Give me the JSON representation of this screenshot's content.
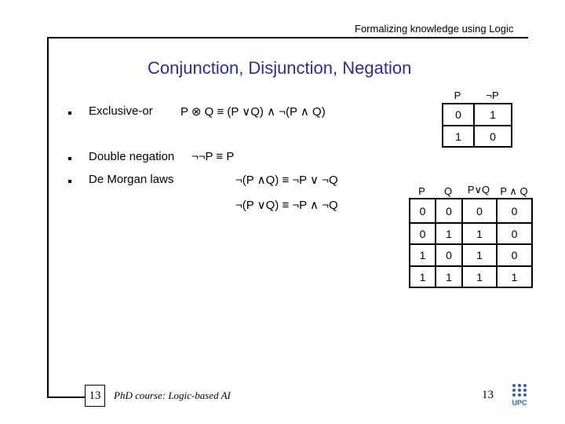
{
  "header": {
    "title": "Formalizing knowledge using Logic"
  },
  "slide": {
    "title": "Conjunction, Disjunction, Negation",
    "items": [
      {
        "label": "Exclusive-or",
        "formula": "P ⊗  Q ≡ (P ∨Q) ∧ ¬(P ∧ Q)"
      },
      {
        "label": "Double negation",
        "formula": "¬¬P ≡ P"
      },
      {
        "label": "De Morgan laws",
        "formulas": [
          "¬(P ∧Q) ≡ ¬P ∨ ¬Q",
          "¬(P ∨Q) ≡ ¬P ∧ ¬Q"
        ]
      }
    ]
  },
  "negation_table": {
    "headers": [
      "P",
      "¬P"
    ],
    "rows": [
      [
        "0",
        "1"
      ],
      [
        "1",
        "0"
      ]
    ]
  },
  "and_or_table": {
    "headers": [
      "P",
      "Q",
      "P∨Q",
      "P ∧ Q"
    ],
    "rows": [
      [
        "0",
        "0",
        "0",
        "0"
      ],
      [
        "0",
        "1",
        "1",
        "0"
      ],
      [
        "1",
        "0",
        "1",
        "0"
      ],
      [
        "1",
        "1",
        "1",
        "1"
      ]
    ]
  },
  "footer": {
    "page_box": "13",
    "course": "PhD course: Logic-based AI",
    "page_number": "13",
    "logo_text": "UPC"
  },
  "colors": {
    "title": "#2e2e8a",
    "logo": "#2f5fa8"
  }
}
